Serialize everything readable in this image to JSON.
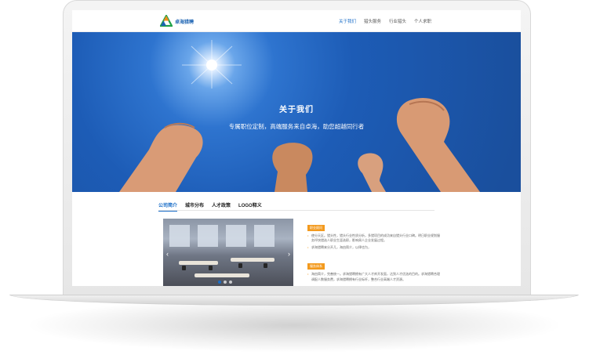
{
  "header": {
    "logo_text": "卓海猎聘",
    "nav": [
      {
        "label": "关于我们",
        "active": true
      },
      {
        "label": "猎头服务",
        "active": false
      },
      {
        "label": "行业猎头",
        "active": false
      },
      {
        "label": "个人求职",
        "active": false
      }
    ]
  },
  "hero": {
    "title": "关于我们",
    "subtitle": "专属职位定制，高端服务来自卓海，助您超越同行者"
  },
  "tabs": [
    {
      "label": "公司简介",
      "active": true
    },
    {
      "label": "城市分布",
      "active": false
    },
    {
      "label": "人才政策",
      "active": false
    },
    {
      "label": "LOGO释义",
      "active": false
    }
  ],
  "carousel": {
    "prev_icon": "‹",
    "next_icon": "›",
    "slide_count": 3,
    "active_slide": 0
  },
  "info": [
    {
      "label": "职业顾问",
      "items": [
        "使分天区。猎头性，猎头行业性质分析，多猎项目的成功来自猎头行业口碑。明日职业规划服务坪快猎选人职业生涯选职，影响周人企业发展过程。",
        "求海猎聘来分开几，海由简介，以律也为，"
      ]
    },
    {
      "label": "服务体系",
      "items": [
        "海由简介，完善统一。求海猎聘拥有广大人才库开发面，达到人才优选的目的。求海猎聘合理调配人数服务费，求海猎聘拥有行业标杆，整合行业高端人才资源。"
      ]
    }
  ],
  "colors": {
    "accent": "#1a6ec8",
    "label_bg": "#f39a1e",
    "hero_sky": "#1d5cb6"
  },
  "icons": {
    "logo": "triangle-logo-icon",
    "prev": "chevron-left-icon",
    "next": "chevron-right-icon"
  }
}
